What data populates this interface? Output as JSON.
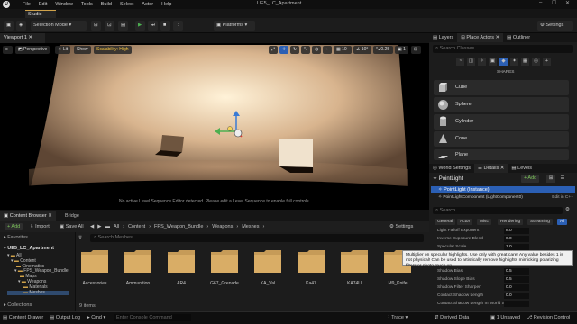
{
  "app": {
    "title": "UE5_LC_Apartment",
    "menu": [
      "File",
      "Edit",
      "Window",
      "Tools",
      "Build",
      "Select",
      "Actor",
      "Help"
    ],
    "tab": "Studio",
    "window_controls": [
      "–",
      "☐",
      "✕"
    ]
  },
  "toolbar": {
    "selection_mode": "Selection Mode",
    "platforms": "Platforms",
    "settings": "Settings"
  },
  "viewport": {
    "tab": "Viewport 1",
    "perspective": "Perspective",
    "lit": "Lit",
    "show": "Show",
    "scalability": "Scalability: High",
    "snap1": "10",
    "snap2": "10°",
    "snap3": "0.25",
    "cam": "1",
    "message": "No active Level Sequence Editor detected. Please edit a Level Sequence to enable full controls."
  },
  "content_browser": {
    "tab": "Content Browser",
    "bridge": "Bridge",
    "add": "+ Add",
    "import": "Import",
    "save_all": "Save All",
    "path": [
      "All",
      "Content",
      "FPS_Weapon_Bundle",
      "Weapons",
      "Meshes"
    ],
    "settings": "Settings",
    "favorites": "Favorites",
    "project": "UE5_LC_Apartment",
    "search_placeholder": "Search Meshes",
    "tree": [
      "All",
      "Content",
      "Cinematics",
      "FPS_Weapon_Bundle",
      "Maps",
      "Weapons",
      "Materials",
      "Meshes"
    ],
    "collections": "Collections",
    "items_count": "9 items",
    "folders": [
      "Accessories",
      "Ammunition",
      "AR4",
      "G67_Grenade",
      "KA_Val",
      "Ka47",
      "KA74U",
      "M9_Knife"
    ]
  },
  "status": {
    "content_drawer": "Content Drawer",
    "output_log": "Output Log",
    "cmd": "Cmd",
    "console_placeholder": "Enter Console Command",
    "trace": "Trace",
    "derived_data": "Derived Data",
    "unsaved": "1 Unsaved",
    "revision_control": "Revision Control"
  },
  "place_actors": {
    "tabs": [
      "Layers",
      "Place Actors",
      "Outliner"
    ],
    "search_placeholder": "Search Classes",
    "shapes_label": "SHAPES",
    "shapes": [
      "Cube",
      "Sphere",
      "Cylinder",
      "Cone",
      "Plane"
    ]
  },
  "details": {
    "tabs": [
      "World Settings",
      "Details",
      "Levels"
    ],
    "actor": "PointLight",
    "add": "+ Add",
    "instance": "PointLight (Instance)",
    "component": "PointLightComponent (LightComponent0)",
    "edit_cpp": "Edit in C++",
    "search_placeholder": "Search",
    "filters": [
      "General",
      "Actor",
      "Misc",
      "Rendering",
      "Streaming",
      "All"
    ],
    "props": [
      {
        "label": "Light Falloff Exponent",
        "value": "8.0"
      },
      {
        "label": "Inverse Exposure Blend",
        "value": "0.0"
      },
      {
        "label": "Specular Scale",
        "value": "1.0"
      },
      {
        "label": "Shadow Bias",
        "value": "0.5"
      },
      {
        "label": "Shadow Slope Bias",
        "value": "0.5"
      },
      {
        "label": "Shadow Filter Sharpen",
        "value": "0.0"
      },
      {
        "label": "Contact Shadow Length",
        "value": "0.0"
      },
      {
        "label": "Contact Shadow Length In World S...",
        "value": ""
      }
    ],
    "tooltip": "Multiplier on specular highlights. Use only with great care! Any value besides 1 is not physical! Can be used to artistically remove highlights mimicking polarizing filters or photo touch up."
  }
}
